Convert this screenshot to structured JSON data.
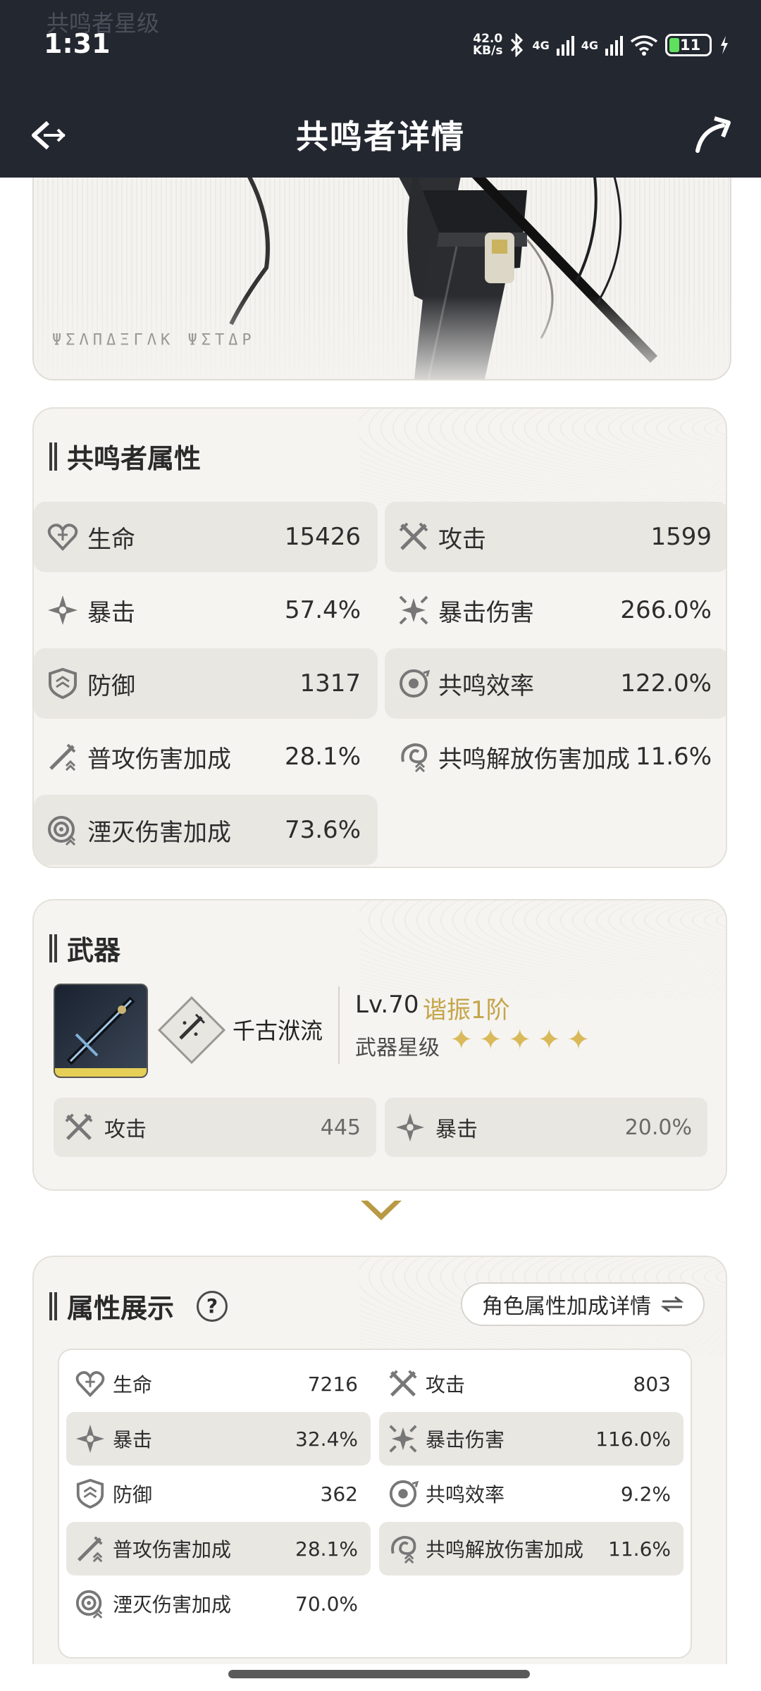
{
  "status": {
    "time": "1:31",
    "net_speed_top": "42.0",
    "net_speed_bottom": "KB/s",
    "sim1": "4G",
    "sim2": "4G",
    "battery": "11"
  },
  "ghost_header": "共鸣者星级",
  "nav": {
    "title": "共鸣者详情"
  },
  "hero": {
    "glyphs": "ΨΣΛΠΔΞΓΛΚ ΨΣΤΔΡ"
  },
  "resonator_stats": {
    "title": "共鸣者属性",
    "items": [
      {
        "label": "生命",
        "value": "15426",
        "icon": "heart-icon"
      },
      {
        "label": "攻击",
        "value": "1599",
        "icon": "crossed-swords-icon"
      },
      {
        "label": "暴击",
        "value": "57.4%",
        "icon": "crit-star-icon"
      },
      {
        "label": "暴击伤害",
        "value": "266.0%",
        "icon": "crit-damage-icon"
      },
      {
        "label": "防御",
        "value": "1317",
        "icon": "shield-icon"
      },
      {
        "label": "共鸣效率",
        "value": "122.0%",
        "icon": "energy-regen-icon"
      },
      {
        "label": "普攻伤害加成",
        "value": "28.1%",
        "icon": "basic-attack-icon"
      },
      {
        "label": "共鸣解放伤害加成",
        "value": "11.6%",
        "icon": "liberation-icon"
      },
      {
        "label": "湮灭伤害加成",
        "value": "73.6%",
        "icon": "havoc-icon"
      }
    ]
  },
  "weapon": {
    "title": "武器",
    "name": "千古洑流",
    "level": "Lv.70",
    "tune": "谐振1阶",
    "star_label": "武器星级",
    "stars": 5,
    "stats": [
      {
        "label": "攻击",
        "value": "445",
        "icon": "crossed-swords-icon"
      },
      {
        "label": "暴击",
        "value": "20.0%",
        "icon": "crit-star-icon"
      }
    ]
  },
  "attribute_display": {
    "title": "属性展示",
    "help": "?",
    "detail_button": "角色属性加成详情",
    "items": [
      {
        "label": "生命",
        "value": "7216",
        "icon": "heart-icon"
      },
      {
        "label": "攻击",
        "value": "803",
        "icon": "crossed-swords-icon"
      },
      {
        "label": "暴击",
        "value": "32.4%",
        "icon": "crit-star-icon"
      },
      {
        "label": "暴击伤害",
        "value": "116.0%",
        "icon": "crit-damage-icon"
      },
      {
        "label": "防御",
        "value": "362",
        "icon": "shield-icon"
      },
      {
        "label": "共鸣效率",
        "value": "9.2%",
        "icon": "energy-regen-icon"
      },
      {
        "label": "普攻伤害加成",
        "value": "28.1%",
        "icon": "basic-attack-icon"
      },
      {
        "label": "共鸣解放伤害加成",
        "value": "11.6%",
        "icon": "liberation-icon"
      },
      {
        "label": "湮灭伤害加成",
        "value": "70.0%",
        "icon": "havoc-icon"
      }
    ]
  },
  "colors": {
    "gold": "#c5a54a",
    "header_bg": "#232730",
    "row_shade": "#e9e7e2"
  }
}
